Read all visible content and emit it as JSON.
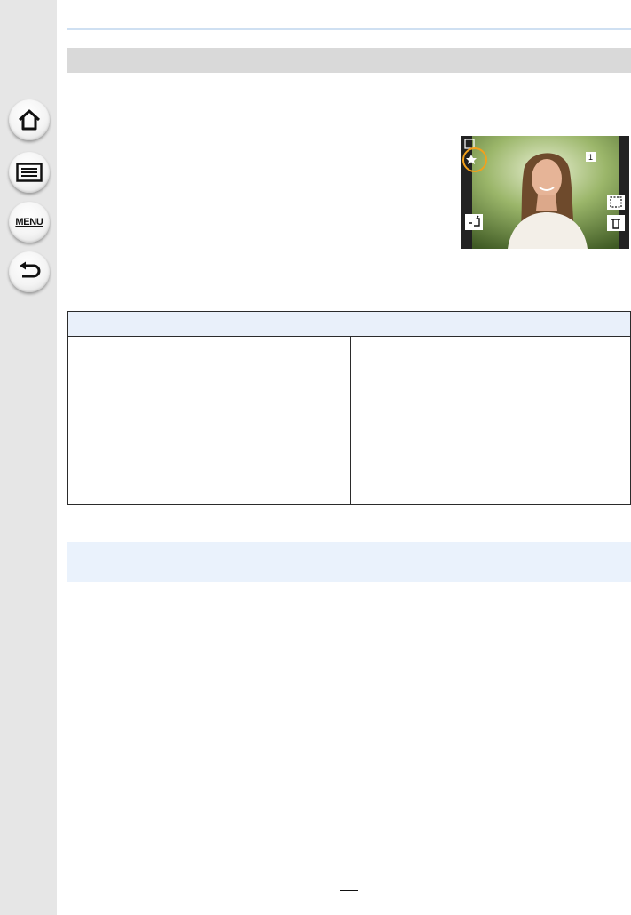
{
  "sidebar": {
    "buttons": [
      {
        "name": "home",
        "icon": "home-icon"
      },
      {
        "name": "contents",
        "icon": "list-icon"
      },
      {
        "name": "menu",
        "icon": "menu-icon",
        "label": "MENU"
      },
      {
        "name": "back",
        "icon": "back-arrow-icon"
      }
    ]
  },
  "photo": {
    "frame_number": "1",
    "icons": [
      "favorite-star-icon",
      "play-mode-icon",
      "face-detect-icon",
      "delete-icon",
      "upload-icon"
    ],
    "highlight_color": "#f2a01c"
  },
  "colors": {
    "sidebar_bg": "#e6e6e6",
    "section_bar": "#d9d9d9",
    "table_header": "#e9f0fa",
    "note_bg": "#eaf2fc"
  }
}
